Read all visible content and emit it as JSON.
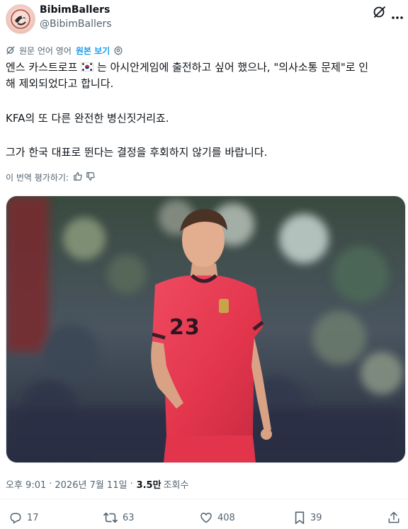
{
  "author": {
    "display_name": "BibimBallers",
    "handle": "@BibimBallers"
  },
  "translation": {
    "notice": "원문 언어 영어",
    "show_original": "원본 보기"
  },
  "tweet": {
    "line1_before_flag": "엔스 카스트로프",
    "line1_after_flag": "는 아시안게임에 출전하고 싶어 했으나, \"의사소통 문제\"로 인",
    "line2": "해 제외되었다고 합니다.",
    "line3": "KFA의 또 다른 완전한 병신짓거리죠.",
    "line4": "그가 한국 대표로 뛴다는 결정을 후회하지 않기를 바랍니다."
  },
  "rate_translation": "이 번역 평가하기:",
  "media": {
    "jersey_number": "23"
  },
  "meta": {
    "time": "오후 9:01",
    "date": "2026년 7월 11일",
    "separator": "·",
    "views_count": "3.5만",
    "views_label": "조회수"
  },
  "actions": {
    "replies": "17",
    "reposts": "63",
    "likes": "408",
    "bookmarks": "39"
  },
  "colors": {
    "accent": "#1d9bf0",
    "secondary_text": "#536471",
    "jersey_red": "#e2354c"
  }
}
